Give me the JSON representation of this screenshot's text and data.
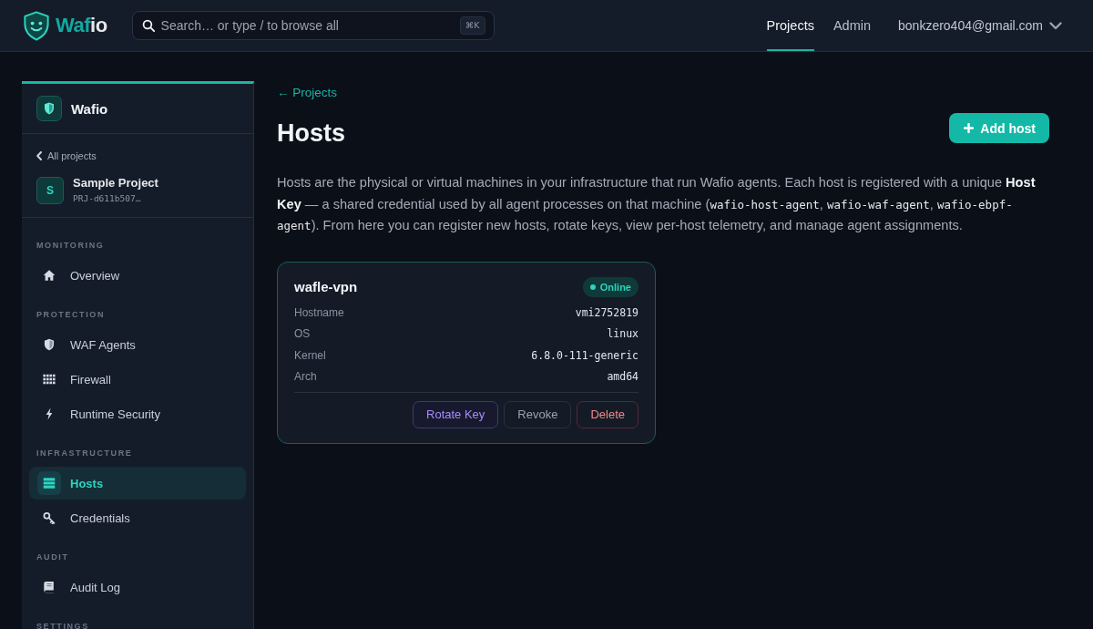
{
  "topbar": {
    "brand": {
      "accent": "Waf",
      "rest": "io"
    },
    "search": {
      "placeholder": "Search… or type / to browse all",
      "shortcut": "⌘K"
    },
    "nav": [
      {
        "label": "Projects",
        "selected": true
      },
      {
        "label": "Admin",
        "selected": false
      }
    ],
    "user": {
      "email": "bonkzero404@gmail.com"
    }
  },
  "sidebar": {
    "brand": "Wafio",
    "back_link": "All projects",
    "project": {
      "avatar": "S",
      "name": "Sample Project",
      "id": "PRJ-d611b507…"
    },
    "sections": [
      {
        "heading": "MONITORING",
        "items": [
          {
            "label": "Overview",
            "selected": false
          }
        ]
      },
      {
        "heading": "PROTECTION",
        "items": [
          {
            "label": "WAF Agents",
            "selected": false
          },
          {
            "label": "Firewall",
            "selected": false
          },
          {
            "label": "Runtime Security",
            "selected": false
          }
        ]
      },
      {
        "heading": "INFRASTRUCTURE",
        "items": [
          {
            "label": "Hosts",
            "selected": true
          },
          {
            "label": "Credentials",
            "selected": false
          }
        ]
      },
      {
        "heading": "AUDIT",
        "items": [
          {
            "label": "Audit Log",
            "selected": false
          }
        ]
      },
      {
        "heading": "SETTINGS"
      }
    ]
  },
  "main": {
    "back_link": "← Projects",
    "title": "Hosts",
    "add_button": "Add host",
    "description": [
      {
        "kind": "text",
        "text": "Hosts are the physical or virtual machines in your infrastructure that run Wafio agents. Each host is registered with a unique "
      },
      {
        "kind": "bold",
        "text": "Host Key"
      },
      {
        "kind": "text",
        "text": " — a shared credential used by all agent processes on that machine ("
      },
      {
        "kind": "code",
        "text": "wafio-host-agent"
      },
      {
        "kind": "text",
        "text": ", "
      },
      {
        "kind": "code",
        "text": "wafio-waf-agent"
      },
      {
        "kind": "text",
        "text": ", "
      },
      {
        "kind": "code",
        "text": "wafio-ebpf-agent"
      },
      {
        "kind": "text",
        "text": "). From here you can register new hosts, rotate keys, view per-host telemetry, and manage agent assignments."
      }
    ],
    "hosts": [
      {
        "name": "wafle-vpn",
        "status": "Online",
        "online": true,
        "fields": [
          {
            "label": "Hostname",
            "value": "vmi2752819"
          },
          {
            "label": "OS",
            "value": "linux"
          },
          {
            "label": "Kernel",
            "value": "6.8.0-111-generic"
          },
          {
            "label": "Arch",
            "value": "amd64"
          }
        ],
        "actions": [
          {
            "label": "Rotate Key",
            "kind": "accent"
          },
          {
            "label": "Revoke",
            "kind": "neutral"
          },
          {
            "label": "Delete",
            "kind": "danger"
          }
        ]
      }
    ]
  }
}
